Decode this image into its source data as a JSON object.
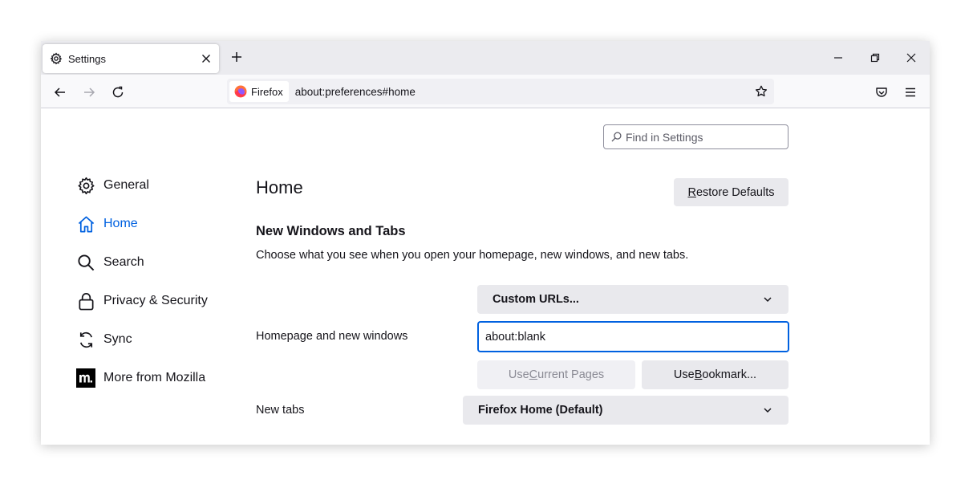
{
  "tab": {
    "title": "Settings"
  },
  "urlbar": {
    "identity_label": "Firefox",
    "url": "about:preferences#home"
  },
  "find": {
    "placeholder": "Find in Settings"
  },
  "sidebar": {
    "items": [
      {
        "label": "General",
        "icon": "gear-icon"
      },
      {
        "label": "Home",
        "icon": "home-icon",
        "selected": true
      },
      {
        "label": "Search",
        "icon": "search-icon"
      },
      {
        "label": "Privacy & Security",
        "icon": "lock-icon"
      },
      {
        "label": "Sync",
        "icon": "sync-icon"
      },
      {
        "label": "More from Mozilla",
        "icon": "mozilla-icon"
      }
    ]
  },
  "main": {
    "title": "Home",
    "restore_defaults": {
      "pre": "",
      "accel": "R",
      "post": "estore Defaults"
    },
    "section_title": "New Windows and Tabs",
    "section_desc": "Choose what you see when you open your homepage, new windows, and new tabs.",
    "homepage_select": "Custom URLs...",
    "homepage_label": "Homepage and new windows",
    "homepage_value": "about:blank",
    "use_current": {
      "pre": "Use ",
      "accel": "C",
      "post": "urrent Pages"
    },
    "use_bookmark": {
      "pre": "Use ",
      "accel": "B",
      "post": "ookmark..."
    },
    "newtabs_label": "New tabs",
    "newtabs_select": "Firefox Home (Default)"
  },
  "colors": {
    "accent": "#0061e0",
    "text": "#15141a",
    "button": "#e9e9ed"
  }
}
